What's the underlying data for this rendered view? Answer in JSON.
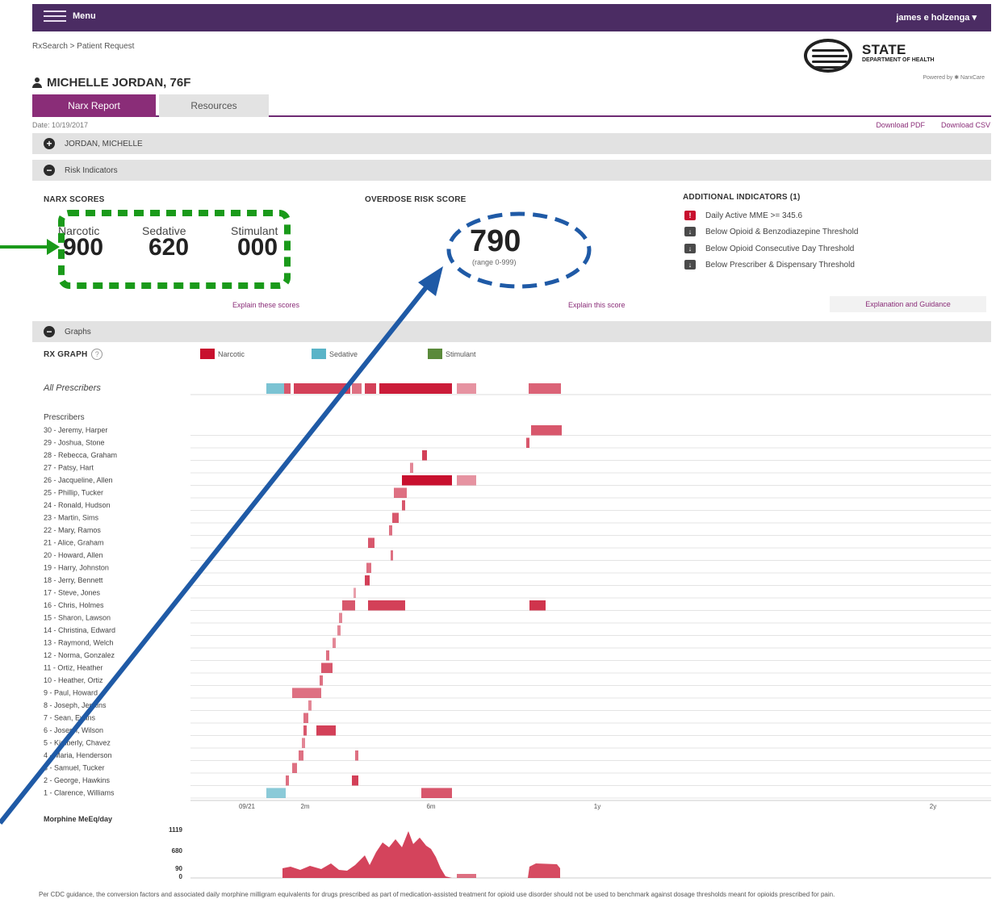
{
  "topbar": {
    "menu_label": "Menu",
    "user": "james e holzenga ▾"
  },
  "breadcrumb": "RxSearch > Patient Request",
  "logo": {
    "name": "STATE",
    "dept": "DEPARTMENT OF HEALTH",
    "powered": "Powered by ✱ NarxCare"
  },
  "patient": {
    "title": "MICHELLE JORDAN, 76F"
  },
  "tabs": {
    "active": "Narx Report",
    "inactive": "Resources"
  },
  "report": {
    "date": "Date: 10/19/2017",
    "download_pdf": "Download PDF",
    "download_csv": "Download CSV"
  },
  "sections": {
    "patient": "JORDAN, MICHELLE",
    "risk": "Risk Indicators",
    "graphs": "Graphs"
  },
  "narx": {
    "heading": "NARX SCORES",
    "scores": [
      {
        "label": "Narcotic",
        "value": "900"
      },
      {
        "label": "Sedative",
        "value": "620"
      },
      {
        "label": "Stimulant",
        "value": "000"
      }
    ],
    "explain": "Explain these scores"
  },
  "overdose": {
    "heading": "OVERDOSE RISK SCORE",
    "value": "790",
    "range": "(range 0-999)",
    "explain": "Explain this score"
  },
  "additional": {
    "heading": "ADDITIONAL INDICATORS (1)",
    "items": [
      {
        "text": "Daily Active MME >= 345.6",
        "status": "alert"
      },
      {
        "text": "Below Opioid & Benzodiazepine Threshold",
        "status": "ok"
      },
      {
        "text": "Below Opioid Consecutive Day Threshold",
        "status": "ok"
      },
      {
        "text": "Below Prescriber & Dispensary Threshold",
        "status": "ok"
      }
    ],
    "guidance": "Explanation and Guidance"
  },
  "colors": {
    "narcotic": "#c8102e",
    "sedative": "#5ab4c8",
    "stimulant": "#5a8a3a",
    "brand": "#4b2c63",
    "accent": "#8a2d78",
    "annotation_green": "#1a9a1a",
    "annotation_blue": "#1f5aa6"
  },
  "rx_graph": {
    "heading": "RX GRAPH",
    "help": "?",
    "legend": [
      "Narcotic",
      "Sedative",
      "Stimulant"
    ],
    "all_label": "All Prescribers",
    "prescribers_label": "Prescribers",
    "prescribers": [
      "30 - Jeremy, Harper",
      "29 - Joshua, Stone",
      "28 - Rebecca, Graham",
      "27 - Patsy, Hart",
      "26 - Jacqueline, Allen",
      "25 - Phillip, Tucker",
      "24 - Ronald, Hudson",
      "23 - Martin, Sims",
      "22 - Mary, Ramos",
      "21 - Alice, Graham",
      "20 - Howard, Allen",
      "19 - Harry, Johnston",
      "18 - Jerry, Bennett",
      "17 - Steve, Jones",
      "16 - Chris, Holmes",
      "15 - Sharon, Lawson",
      "14 - Christina, Edward",
      "13 - Raymond, Welch",
      "12 - Norma, Gonzalez",
      "11 - Ortiz, Heather",
      "10 - Heather, Ortiz",
      "9 - Paul, Howard",
      "8 - Joseph, Jenkins",
      "7 - Sean, Evans",
      "6 - Joseph, Wilson",
      "5 - Kimberly, Chavez",
      "4 - Maria, Henderson",
      "3 - Samuel, Tucker",
      "2 - George, Hawkins",
      "1 - Clarence, Williams"
    ],
    "x_ticks": [
      "09/21",
      "2m",
      "6m",
      "1y",
      "2y"
    ]
  },
  "mme": {
    "heading": "Morphine MeEq/day",
    "ticks": [
      "1119",
      "680",
      "90",
      "0"
    ]
  },
  "footnote": "Per CDC guidance, the conversion factors and associated daily morphine milligram equivalents for drugs prescribed as part of medication-assisted treatment for opioid use disorder should not be used to benchmark against dosage thresholds meant for opioids prescribed for pain."
}
